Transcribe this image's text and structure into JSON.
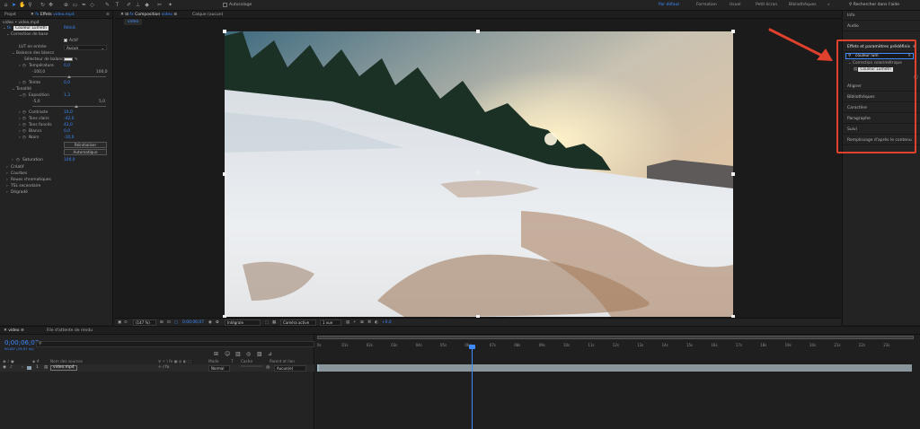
{
  "toolbar": {
    "auto_orient_label": "Autocalage",
    "workspaces": [
      {
        "label": "Par défaut",
        "active": true
      },
      {
        "label": "Formation",
        "active": false
      },
      {
        "label": "Usuel",
        "active": false
      },
      {
        "label": "Petit écran",
        "active": false
      },
      {
        "label": "Bibliothèques",
        "active": false
      }
    ],
    "more": "»",
    "search_help": "Rechercher dans l'aide"
  },
  "left_panel": {
    "tab_project": "Projet",
    "tab_effects_prefix": "fx",
    "tab_effects": "Effets",
    "tab_effects_target": "video.mp4",
    "breadcrumb": "video • video.mp4",
    "effect_name": "Couleur Lumetri",
    "reset": "Réinit.",
    "basic_correction": "Correction de base",
    "active_label": "Actif",
    "lut_label": "LUT en entrée",
    "lut_value": "Aucun",
    "white_balance": "Balance des blancs",
    "wb_selector": "Sélecteur de balance",
    "temperature_label": "Température",
    "temperature_value": "0,0",
    "temp_min": "-100,0",
    "temp_max": "100,0",
    "tint_label": "Teinte",
    "tint_value": "0,0",
    "tonality": "Tonalité",
    "exposure_label": "Exposition",
    "exposure_value": "1,3",
    "exp_min": "-5,0",
    "exp_max": "5,0",
    "contrast_label": "Contraste",
    "contrast_value": "10,0",
    "highlights_label": "Tons clairs",
    "highlights_value": "-42,0",
    "shadows_label": "Tons foncés",
    "shadows_value": "43,0",
    "whites_label": "Blancs",
    "whites_value": "0,0",
    "blacks_label": "Noirs",
    "blacks_value": "-10,0",
    "btn_reset": "Réinitialiser",
    "btn_auto": "Automatique",
    "saturation_label": "Saturation",
    "saturation_value": "100,0",
    "sections": [
      "Créatif",
      "Courbes",
      "Roues chromatiques",
      "TSL secondaire",
      "Dégradé"
    ]
  },
  "comp_panel": {
    "tab_prefix": "fx",
    "tab_composition": "Composition",
    "tab_comp_name": "video",
    "tab_layer": "Calque (aucun)",
    "sub_tab": "video",
    "zoom": "(147 %)",
    "timecode": "0;00;06;07",
    "resolution": "Intégrale",
    "camera": "Caméra active",
    "views": "1 vue",
    "plus_value": "+0,0"
  },
  "right_panel": {
    "info": "Info",
    "audio": "Audio",
    "effects_presets": "Effets et paramètres prédéfinis",
    "search_value": "couleur lum",
    "category": "Correction colorimétrique",
    "result_item": "Couleur Lumetri",
    "sections": [
      "Aligner",
      "Bibliothèques",
      "Caractère",
      "Paragraphe",
      "Suivi",
      "Remplissage d'après le contenu"
    ],
    "highlight_color": "#e0412d"
  },
  "timeline": {
    "tab_comp": "video",
    "tab_render": "File d'attente de rendu",
    "timecode": "0;00;06;07",
    "timecode_sub": "00187 (29,97 i/s)",
    "col_source": "Nom des sources",
    "col_mode": "Mode",
    "col_t": "T",
    "col_cache": "Cache",
    "col_parent": "Parent et lien",
    "layer_index": "1",
    "layer_name": "video.mp4",
    "layer_mode": "Normal",
    "layer_parent": "Aucun(e)",
    "ruler": [
      "0s",
      "01s",
      "02s",
      "03s",
      "04s",
      "05s",
      "06s",
      "07s",
      "08s",
      "09s",
      "10s",
      "11s",
      "12s",
      "13s",
      "14s",
      "15s",
      "16s",
      "17s",
      "18s",
      "19s",
      "20s",
      "21s",
      "22s",
      "23s"
    ],
    "accent_color": "#3d8bff"
  }
}
